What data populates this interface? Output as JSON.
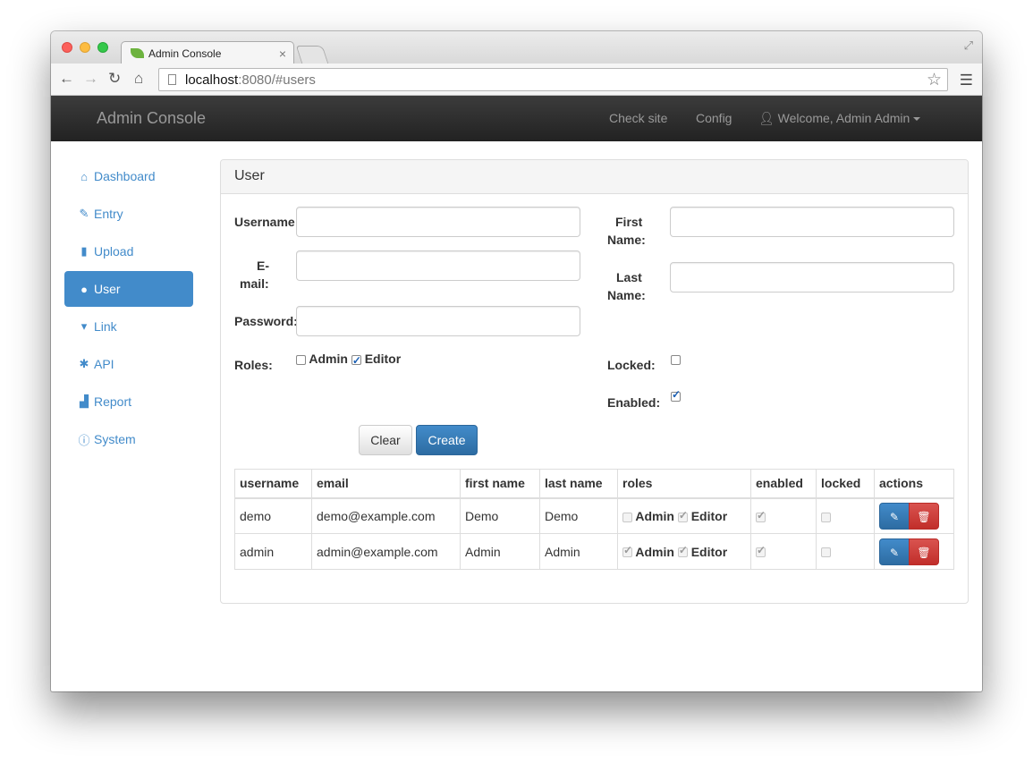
{
  "browser": {
    "tab_title": "Admin Console",
    "tab_close": "×",
    "url_host": "localhost",
    "url_path": ":8080/#users"
  },
  "navbar": {
    "brand": "Admin Console",
    "links": [
      "Check site",
      "Config"
    ],
    "user_menu": "Welcome, Admin Admin"
  },
  "sidebar": {
    "items": [
      {
        "label": "Dashboard",
        "icon": "home-icon"
      },
      {
        "label": "Entry",
        "icon": "pencil-icon"
      },
      {
        "label": "Upload",
        "icon": "file-icon"
      },
      {
        "label": "User",
        "icon": "user-icon",
        "active": true
      },
      {
        "label": "Link",
        "icon": "bookmark-icon"
      },
      {
        "label": "API",
        "icon": "asterisk-icon"
      },
      {
        "label": "Report",
        "icon": "stats-icon"
      },
      {
        "label": "System",
        "icon": "info-icon"
      }
    ]
  },
  "panel": {
    "title": "User",
    "form": {
      "username_label": "Username:",
      "email_label_1": "E-",
      "email_label_2": "mail:",
      "password_label": "Password:",
      "firstname_label_1": "First",
      "firstname_label_2": "Name:",
      "lastname_label_1": "Last",
      "lastname_label_2": "Name:",
      "roles_label": "Roles:",
      "role_admin": "Admin",
      "role_editor": "Editor",
      "locked_label": "Locked:",
      "enabled_label": "Enabled:",
      "clear_button": "Clear",
      "create_button": "Create"
    },
    "table": {
      "headers": [
        "username",
        "email",
        "first name",
        "last name",
        "roles",
        "enabled",
        "locked",
        "actions"
      ],
      "rows": [
        {
          "username": "demo",
          "email": "demo@example.com",
          "first_name": "Demo",
          "last_name": "Demo",
          "admin": false,
          "editor": true,
          "enabled": true,
          "locked": false
        },
        {
          "username": "admin",
          "email": "admin@example.com",
          "first_name": "Admin",
          "last_name": "Admin",
          "admin": true,
          "editor": true,
          "enabled": true,
          "locked": false
        }
      ],
      "role_admin": "Admin",
      "role_editor": "Editor"
    }
  },
  "colors": {
    "accent": "#428bca",
    "danger": "#d9534f",
    "navbar": "#222222"
  }
}
